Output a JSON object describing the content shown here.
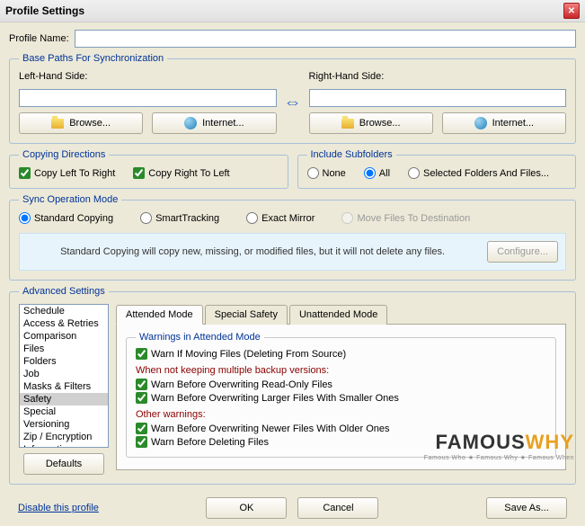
{
  "window": {
    "title": "Profile Settings"
  },
  "profile": {
    "name_label": "Profile Name:",
    "name_value": ""
  },
  "paths": {
    "legend": "Base Paths For Synchronization",
    "left_label": "Left-Hand Side:",
    "right_label": "Right-Hand Side:",
    "left_value": "",
    "right_value": "",
    "browse_label": "Browse...",
    "internet_label": "Internet..."
  },
  "copying": {
    "legend": "Copying Directions",
    "ltr_label": "Copy Left To Right",
    "rtl_label": "Copy Right To Left"
  },
  "subfolders": {
    "legend": "Include Subfolders",
    "none_label": "None",
    "all_label": "All",
    "selected_label": "Selected Folders And Files..."
  },
  "sync_mode": {
    "legend": "Sync Operation Mode",
    "standard_label": "Standard Copying",
    "smart_label": "SmartTracking",
    "exact_label": "Exact Mirror",
    "move_label": "Move Files To Destination",
    "info_text": "Standard Copying will copy new, missing, or modified files, but it will not delete any files.",
    "configure_label": "Configure..."
  },
  "advanced": {
    "legend": "Advanced Settings",
    "items": [
      "Schedule",
      "Access & Retries",
      "Comparison",
      "Files",
      "Folders",
      "Job",
      "Masks & Filters",
      "Safety",
      "Special",
      "Versioning",
      "Zip / Encryption",
      "Information"
    ],
    "selected_index": 7,
    "tabs": [
      "Attended Mode",
      "Special Safety",
      "Unattended Mode"
    ],
    "active_tab": 0,
    "warnings_legend": "Warnings in Attended Mode",
    "warn_moving": "Warn If Moving Files (Deleting From Source)",
    "section_backup": "When not keeping multiple backup versions:",
    "warn_readonly": "Warn Before Overwriting Read-Only Files",
    "warn_larger": "Warn Before Overwriting Larger Files With Smaller Ones",
    "section_other": "Other warnings:",
    "warn_newer": "Warn Before Overwriting Newer Files With Older Ones",
    "warn_deleting": "Warn Before Deleting Files",
    "defaults_label": "Defaults"
  },
  "footer": {
    "disable_label": "Disable this profile",
    "ok_label": "OK",
    "cancel_label": "Cancel",
    "save_as_label": "Save As..."
  },
  "watermark": {
    "brand1": "FAMOUS",
    "brand2": "WHY",
    "tagline": "Famous Who ★ Famous Why ★ Famous When"
  }
}
